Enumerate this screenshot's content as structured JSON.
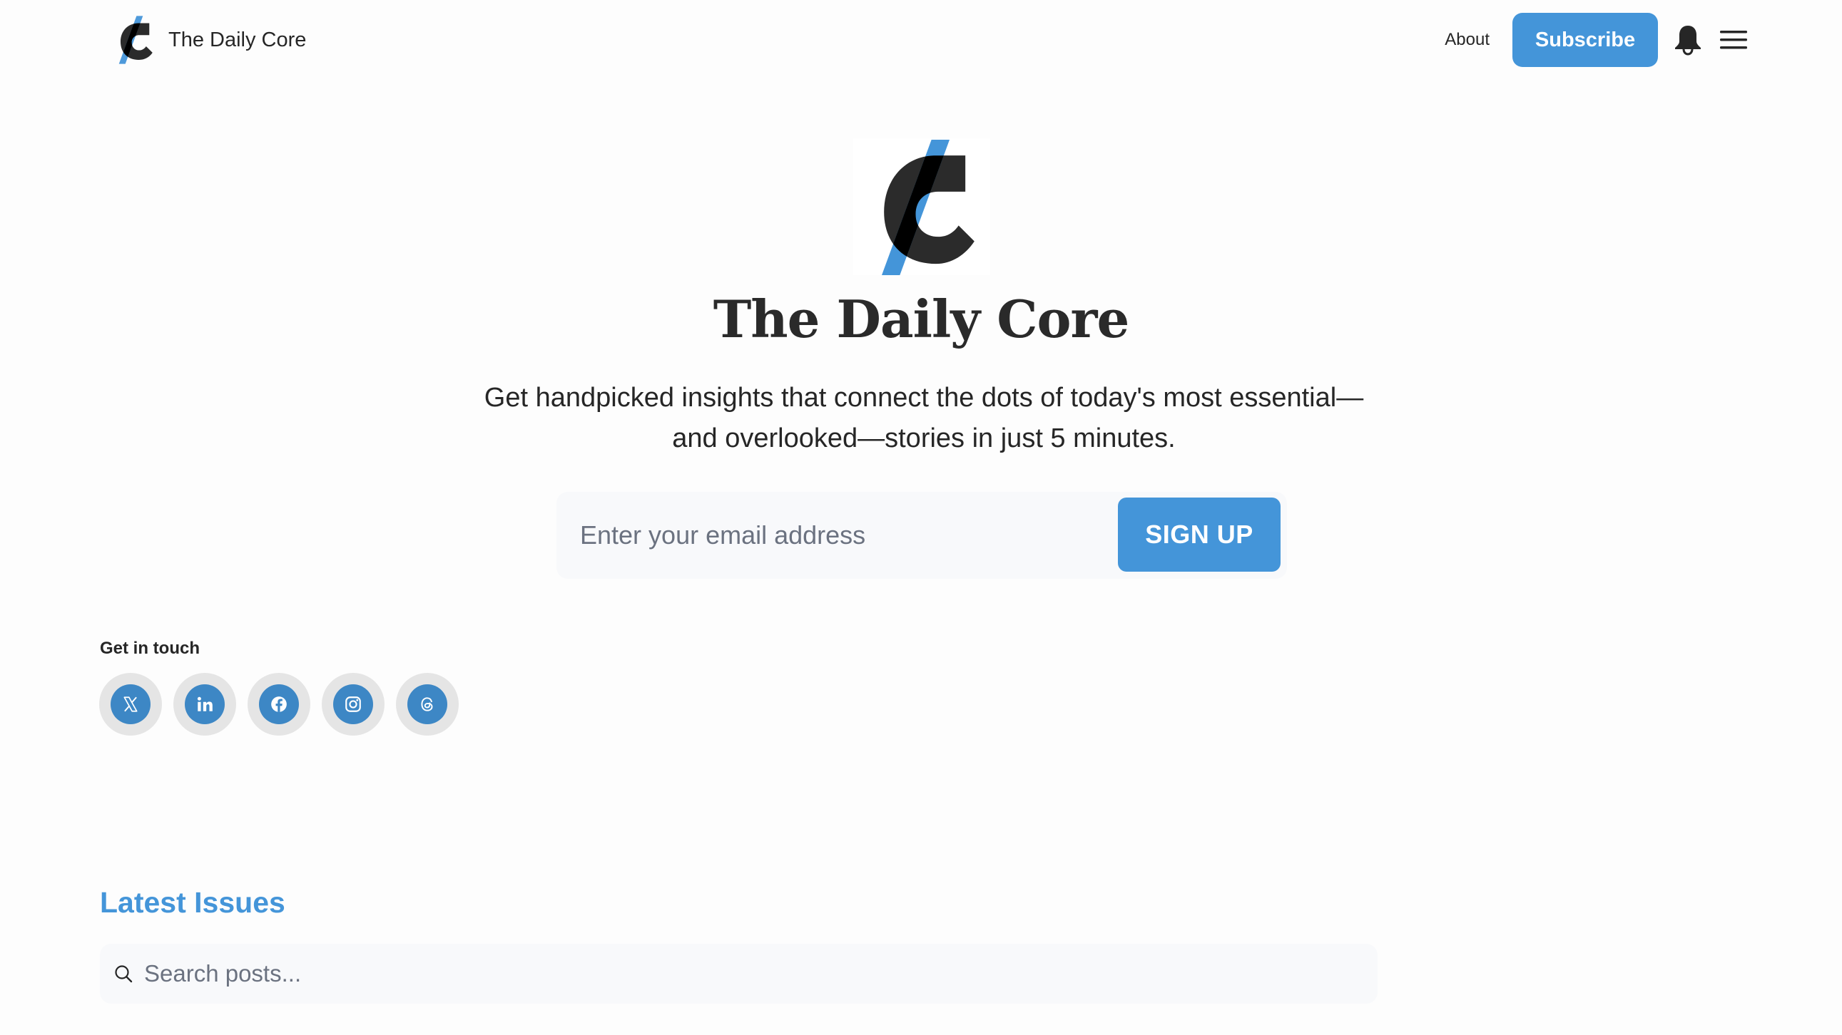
{
  "header": {
    "brand_name": "The Daily Core",
    "nav_about": "About",
    "subscribe_label": "Subscribe",
    "icons": {
      "logo": "daily-core-logo",
      "bell": "bell-icon",
      "menu": "hamburger-menu-icon"
    }
  },
  "hero": {
    "title": "The Daily Core",
    "subtitle_line1": "Get handpicked insights that connect the dots of today's most essential—",
    "subtitle_line2": "and overlooked—stories in just 5 minutes.",
    "email_placeholder": "Enter your email address",
    "email_value": "",
    "signup_label": "SIGN UP"
  },
  "contact": {
    "label": "Get in touch",
    "socials": [
      {
        "name": "X",
        "icon": "x-icon"
      },
      {
        "name": "LinkedIn",
        "icon": "linkedin-icon"
      },
      {
        "name": "Facebook",
        "icon": "facebook-icon"
      },
      {
        "name": "Instagram",
        "icon": "instagram-icon"
      },
      {
        "name": "Threads",
        "icon": "threads-icon"
      }
    ]
  },
  "latest": {
    "title": "Latest Issues",
    "search_placeholder": "Search posts...",
    "search_value": ""
  },
  "colors": {
    "accent": "#4495d9",
    "social_blue": "#3d87c5",
    "social_ring": "#e5e5e5",
    "text": "#262626",
    "field_bg": "#f8f9fb",
    "page_bg": "#fdfdfd"
  }
}
